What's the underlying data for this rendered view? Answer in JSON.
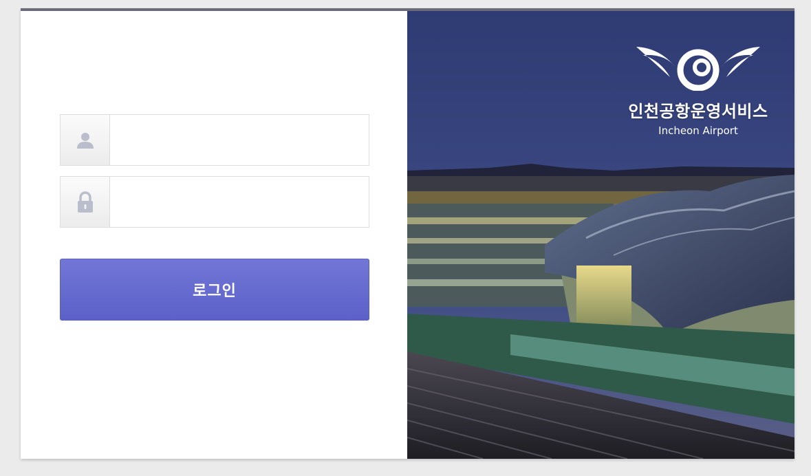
{
  "login": {
    "username_icon": "user-icon",
    "password_icon": "lock-icon",
    "username_value": "",
    "username_placeholder": "",
    "password_value": "",
    "password_placeholder": "",
    "submit_label": "로그인"
  },
  "branding": {
    "logo_icon": "incheon-airport-wing-logo",
    "company_name": "인천공항운영서비스",
    "company_name_en": "Incheon Airport"
  },
  "colors": {
    "accent": "#6569cf",
    "header_bar": "#6b6c77",
    "background": "#ebebeb"
  }
}
